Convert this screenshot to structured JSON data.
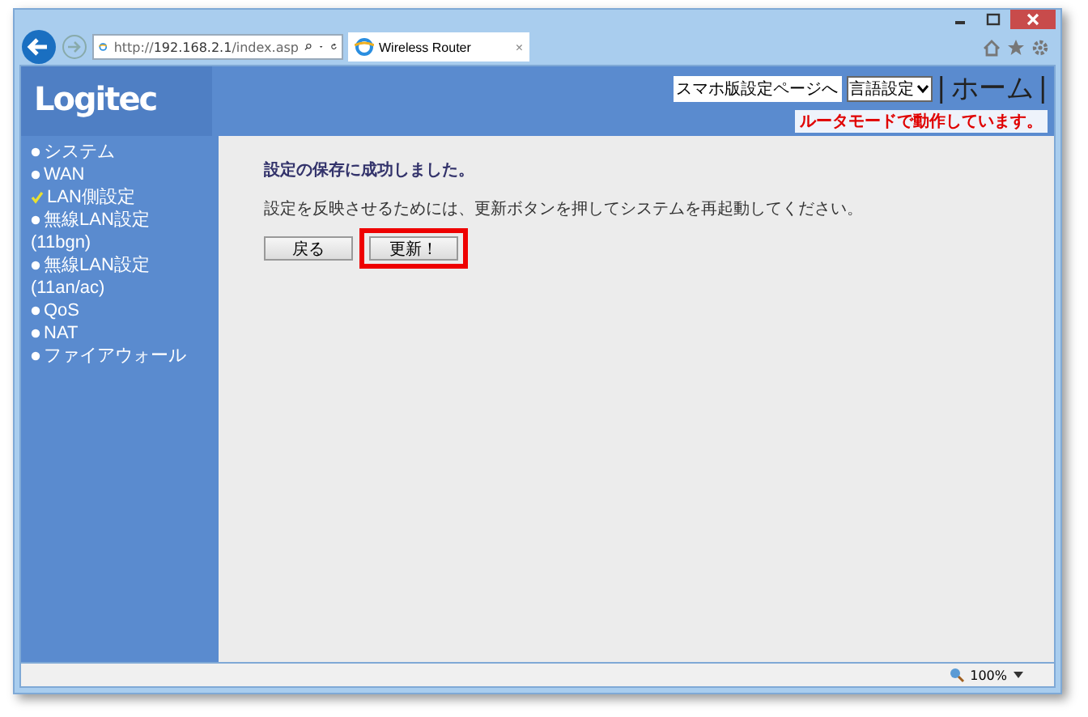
{
  "browser": {
    "url_prefix": "http://",
    "url_host": "192.168.2.1",
    "url_path": "/index.asp",
    "tab_title": "Wireless Router",
    "tab_close": "×",
    "zoom": "100%"
  },
  "header": {
    "logo": "Logitec",
    "smartphone_link": "スマホ版設定ページへ",
    "language_select": "言語設定",
    "home_link": "ホーム",
    "separator_left": "|",
    "separator_right": "|",
    "mode_notice": "ルータモードで動作しています。"
  },
  "sidebar": {
    "items": [
      {
        "label": "システム",
        "selected": false
      },
      {
        "label": "WAN",
        "selected": false
      },
      {
        "label": "LAN側設定",
        "selected": true
      },
      {
        "label": "無線LAN設定 (11bgn)",
        "selected": false
      },
      {
        "label": "無線LAN設定 (11an/ac)",
        "selected": false
      },
      {
        "label": "QoS",
        "selected": false
      },
      {
        "label": "NAT",
        "selected": false
      },
      {
        "label": "ファイアウォール",
        "selected": false
      }
    ]
  },
  "content": {
    "title": "設定の保存に成功しました。",
    "message": "設定を反映させるためには、更新ボタンを押してシステムを再起動してください。",
    "buttons": [
      {
        "label": "戻る",
        "highlighted": false
      },
      {
        "label": "更新！",
        "highlighted": true
      }
    ]
  }
}
